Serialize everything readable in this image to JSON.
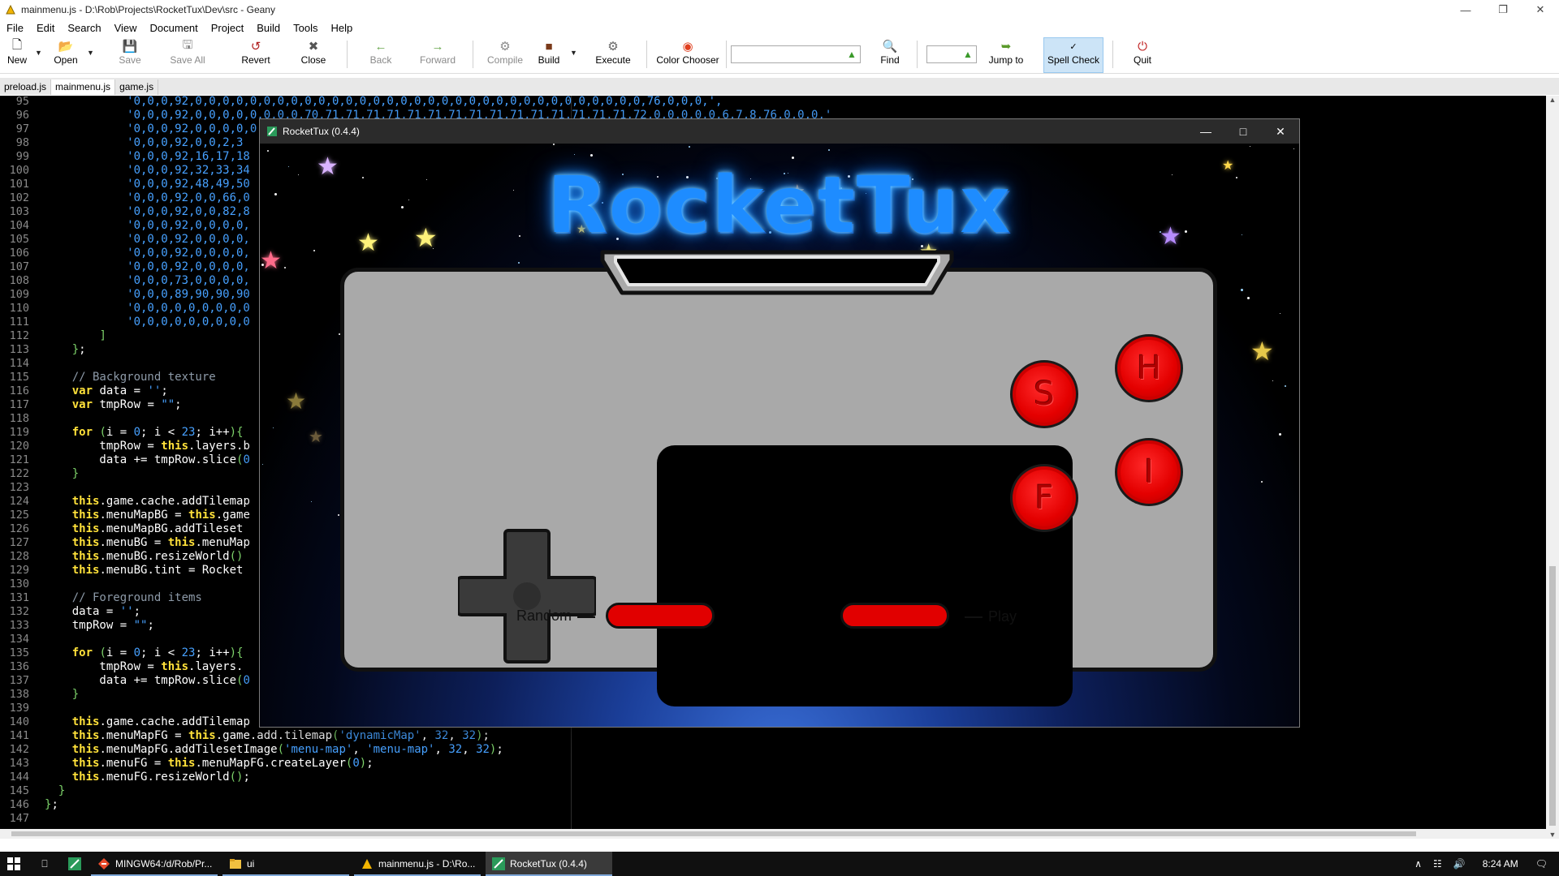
{
  "geany": {
    "title": "mainmenu.js - D:\\Rob\\Projects\\RocketTux\\Dev\\src - Geany",
    "menu": [
      "File",
      "Edit",
      "Search",
      "View",
      "Document",
      "Project",
      "Build",
      "Tools",
      "Help"
    ],
    "toolbar": {
      "new": "New",
      "open": "Open",
      "save": "Save",
      "save_all": "Save All",
      "revert": "Revert",
      "close": "Close",
      "back": "Back",
      "forward": "Forward",
      "compile": "Compile",
      "build": "Build",
      "execute": "Execute",
      "color_chooser": "Color Chooser",
      "search_value": "",
      "find": "Find",
      "goto_value": "",
      "jump_to": "Jump to",
      "spell_check": "Spell Check",
      "quit": "Quit"
    },
    "tabs": [
      "preload.js",
      "mainmenu.js",
      "game.js"
    ],
    "active_tab": "mainmenu.js"
  },
  "editor": {
    "lines": [
      {
        "n": "95",
        "t": "            '0,0,0,92,0,0,0,0,0,0,0,0,0,0,0,0,0,0,0,0,0,0,0,0,0,0,0,0,0,0,0,0,0,0,0,0,0,76,0,0,0,',"
      },
      {
        "n": "96",
        "t": "            '0,0,0,92,0,0,0,0,0,0,0,0,70,71,71,71,71,71,71,71,71,71,71,71,71,71,71,71,72,0,0,0,0,0,6,7,8,76,0,0,0,'"
      },
      {
        "n": "97",
        "t": "            '0,0,0,92,0,0,0,0,0"
      },
      {
        "n": "98",
        "t": "            '0,0,0,92,0,0,2,3"
      },
      {
        "n": "99",
        "t": "            '0,0,0,92,16,17,18"
      },
      {
        "n": "100",
        "t": "            '0,0,0,92,32,33,34"
      },
      {
        "n": "101",
        "t": "            '0,0,0,92,48,49,50"
      },
      {
        "n": "102",
        "t": "            '0,0,0,92,0,0,66,0"
      },
      {
        "n": "103",
        "t": "            '0,0,0,92,0,0,82,8"
      },
      {
        "n": "104",
        "t": "            '0,0,0,92,0,0,0,0,"
      },
      {
        "n": "105",
        "t": "            '0,0,0,92,0,0,0,0,"
      },
      {
        "n": "106",
        "t": "            '0,0,0,92,0,0,0,0,"
      },
      {
        "n": "107",
        "t": "            '0,0,0,92,0,0,0,0,"
      },
      {
        "n": "108",
        "t": "            '0,0,0,73,0,0,0,0,"
      },
      {
        "n": "109",
        "t": "            '0,0,0,89,90,90,90"
      },
      {
        "n": "110",
        "t": "            '0,0,0,0,0,0,0,0,0"
      },
      {
        "n": "111",
        "t": "            '0,0,0,0,0,0,0,0,0"
      },
      {
        "n": "112",
        "t": "        ]"
      },
      {
        "n": "113",
        "t": "    };"
      },
      {
        "n": "114",
        "t": ""
      },
      {
        "n": "115",
        "t": "    // Background texture"
      },
      {
        "n": "116",
        "t": "    var data = '';"
      },
      {
        "n": "117",
        "t": "    var tmpRow = \"\";"
      },
      {
        "n": "118",
        "t": ""
      },
      {
        "n": "119",
        "t": "    for (i = 0; i < 23; i++){"
      },
      {
        "n": "120",
        "t": "        tmpRow = this.layers.b"
      },
      {
        "n": "121",
        "t": "        data += tmpRow.slice(0"
      },
      {
        "n": "122",
        "t": "    }"
      },
      {
        "n": "123",
        "t": ""
      },
      {
        "n": "124",
        "t": "    this.game.cache.addTilemap"
      },
      {
        "n": "125",
        "t": "    this.menuMapBG = this.game"
      },
      {
        "n": "126",
        "t": "    this.menuMapBG.addTileset"
      },
      {
        "n": "127",
        "t": "    this.menuBG = this.menuMap"
      },
      {
        "n": "128",
        "t": "    this.menuBG.resizeWorld()"
      },
      {
        "n": "129",
        "t": "    this.menuBG.tint = Rocket"
      },
      {
        "n": "130",
        "t": ""
      },
      {
        "n": "131",
        "t": "    // Foreground items"
      },
      {
        "n": "132",
        "t": "    data = '';"
      },
      {
        "n": "133",
        "t": "    tmpRow = \"\";"
      },
      {
        "n": "134",
        "t": ""
      },
      {
        "n": "135",
        "t": "    for (i = 0; i < 23; i++){"
      },
      {
        "n": "136",
        "t": "        tmpRow = this.layers."
      },
      {
        "n": "137",
        "t": "        data += tmpRow.slice(0"
      },
      {
        "n": "138",
        "t": "    }"
      },
      {
        "n": "139",
        "t": ""
      },
      {
        "n": "140",
        "t": "    this.game.cache.addTilemap"
      },
      {
        "n": "141",
        "t": "    this.menuMapFG = this.game.add.tilemap('dynamicMap', 32, 32);"
      },
      {
        "n": "142",
        "t": "    this.menuMapFG.addTilesetImage('menu-map', 'menu-map', 32, 32);"
      },
      {
        "n": "143",
        "t": "    this.menuFG = this.menuMapFG.createLayer(0);"
      },
      {
        "n": "144",
        "t": "    this.menuFG.resizeWorld();"
      },
      {
        "n": "145",
        "t": "  }"
      },
      {
        "n": "146",
        "t": "};"
      },
      {
        "n": "147",
        "t": ""
      }
    ]
  },
  "rockettux": {
    "title": "RocketTux (0.4.4)",
    "logo": "RocketTux",
    "buttons": {
      "s": "S",
      "f": "F",
      "h": "H",
      "i": "I"
    },
    "random_label": "Random",
    "play_label": "Play"
  },
  "taskbar": {
    "items": [
      {
        "label": "MINGW64:/d/Rob/Pr..."
      },
      {
        "label": "ui"
      },
      {
        "label": "mainmenu.js - D:\\Ro..."
      },
      {
        "label": "RocketTux (0.4.4)"
      }
    ],
    "time": "8:24 AM"
  },
  "colors": {
    "keyword": "#ffe13a",
    "string": "#47a1ff",
    "comment": "#8d9aa8",
    "pad_body": "#a9a9a9",
    "button_red": "#e10000",
    "logo_blue": "#1e8cff"
  }
}
